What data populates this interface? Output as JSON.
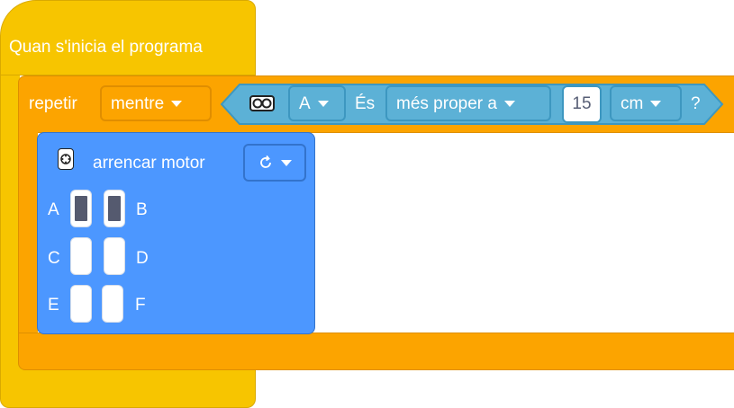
{
  "hat": {
    "label": "Quan s'inicia el programa"
  },
  "repeat": {
    "label": "repetir",
    "mode": "mentre"
  },
  "condition": {
    "sensor_icon": "distance-sensor-icon",
    "port": "A",
    "verb": "És",
    "comparison": "més proper a",
    "value": "15",
    "unit": "cm",
    "question": "?"
  },
  "motor": {
    "icon": "hub-icon",
    "label": "arrencar motor",
    "direction_icon": "clockwise-icon",
    "ports": [
      {
        "left": "A",
        "right": "B",
        "left_selected": true,
        "right_selected": true
      },
      {
        "left": "C",
        "right": "D",
        "left_selected": false,
        "right_selected": false
      },
      {
        "left": "E",
        "right": "F",
        "left_selected": false,
        "right_selected": false
      }
    ]
  },
  "colors": {
    "hat": "#f7c500",
    "control": "#fca400",
    "sensor": "#5cb1d6",
    "motor": "#4c97ff"
  }
}
